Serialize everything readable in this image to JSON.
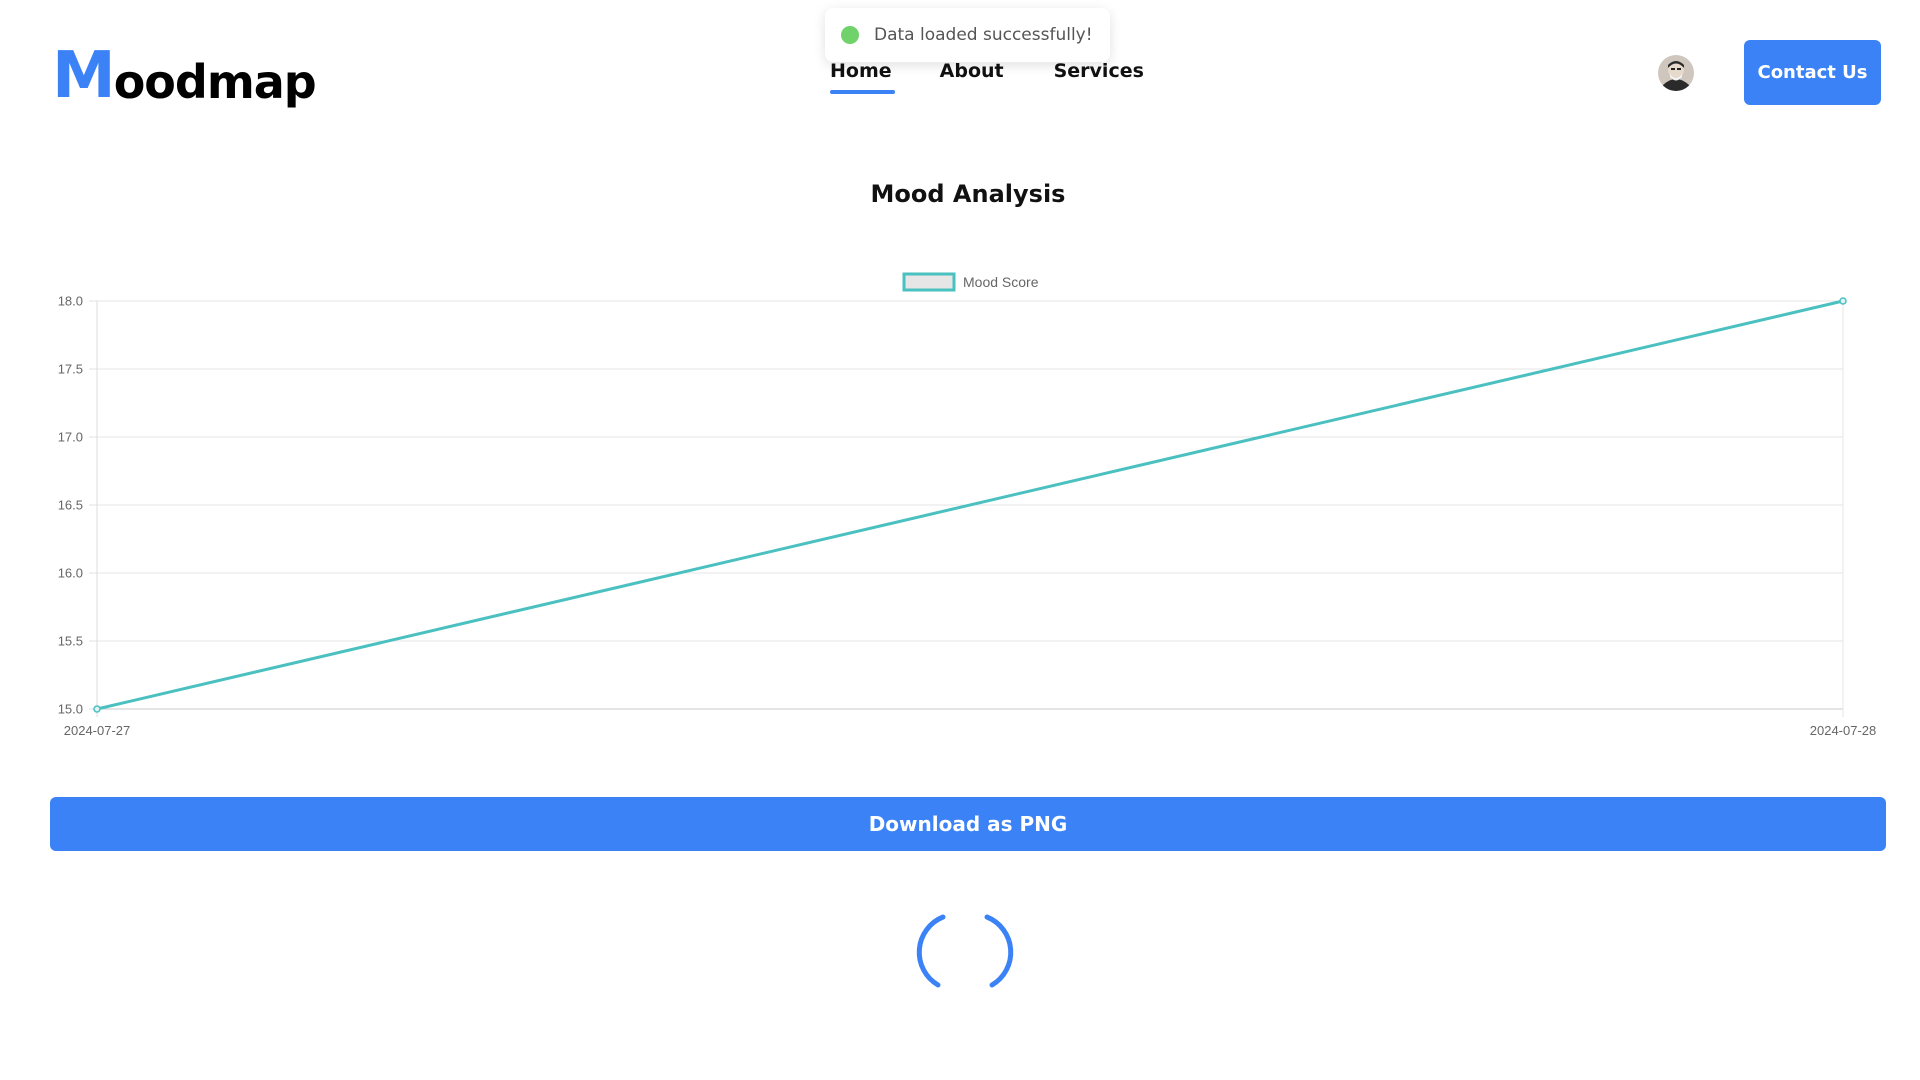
{
  "header": {
    "logo_first": "M",
    "logo_rest": "oodmap",
    "nav": [
      {
        "label": "Home",
        "active": true
      },
      {
        "label": "About",
        "active": false
      },
      {
        "label": "Services",
        "active": false
      }
    ],
    "contact_label": "Contact Us",
    "avatar_icon": "user-avatar"
  },
  "toast": {
    "message": "Data loaded successfully!",
    "status": "success",
    "status_color": "#6fd26a"
  },
  "main": {
    "title": "Mood Analysis",
    "download_label": "Download as PNG",
    "loading_icon": "spinner-icon"
  },
  "colors": {
    "accent": "#3b82f6",
    "series": "#4bc0c0"
  },
  "chart_data": {
    "type": "line",
    "title": "",
    "xlabel": "",
    "ylabel": "",
    "categories": [
      "2024-07-27",
      "2024-07-28"
    ],
    "series": [
      {
        "name": "Mood Score",
        "values": [
          15,
          18
        ],
        "color": "#4bc0c0"
      }
    ],
    "ylim": [
      15.0,
      18.0
    ],
    "yticks": [
      "15.0",
      "15.5",
      "16.0",
      "16.5",
      "17.0",
      "17.5",
      "18.0"
    ],
    "legend_position": "top",
    "grid": true
  }
}
